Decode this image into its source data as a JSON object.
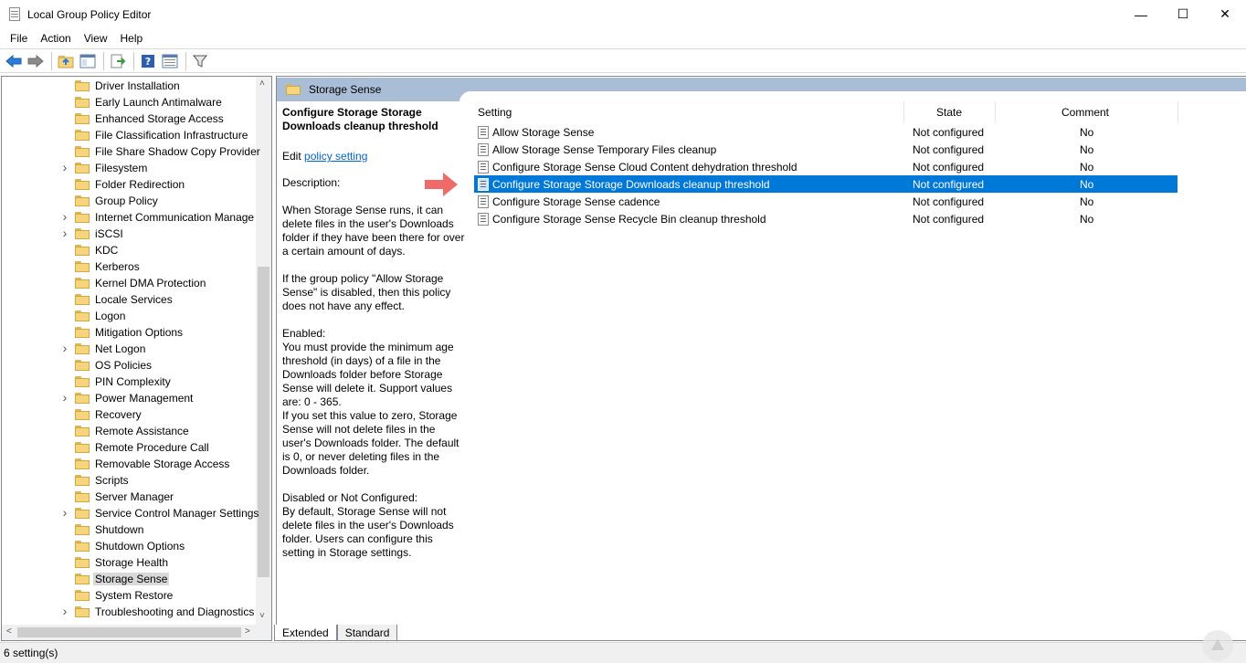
{
  "window": {
    "title": "Local Group Policy Editor"
  },
  "menu": [
    "File",
    "Action",
    "View",
    "Help"
  ],
  "toolbar": {
    "icons": [
      "back-arrow-icon",
      "forward-arrow-icon",
      "up-folder-icon",
      "show-hide-tree-icon",
      "export-list-icon",
      "help-icon",
      "properties-icon",
      "filter-icon"
    ]
  },
  "tree": {
    "items": [
      {
        "label": "Driver Installation",
        "expandable": false
      },
      {
        "label": "Early Launch Antimalware",
        "expandable": false
      },
      {
        "label": "Enhanced Storage Access",
        "expandable": false
      },
      {
        "label": "File Classification Infrastructure",
        "expandable": false
      },
      {
        "label": "File Share Shadow Copy Provider",
        "expandable": false
      },
      {
        "label": "Filesystem",
        "expandable": true
      },
      {
        "label": "Folder Redirection",
        "expandable": false
      },
      {
        "label": "Group Policy",
        "expandable": false
      },
      {
        "label": "Internet Communication Manage",
        "expandable": true
      },
      {
        "label": "iSCSI",
        "expandable": true
      },
      {
        "label": "KDC",
        "expandable": false
      },
      {
        "label": "Kerberos",
        "expandable": false
      },
      {
        "label": "Kernel DMA Protection",
        "expandable": false
      },
      {
        "label": "Locale Services",
        "expandable": false
      },
      {
        "label": "Logon",
        "expandable": false
      },
      {
        "label": "Mitigation Options",
        "expandable": false
      },
      {
        "label": "Net Logon",
        "expandable": true
      },
      {
        "label": "OS Policies",
        "expandable": false
      },
      {
        "label": "PIN Complexity",
        "expandable": false
      },
      {
        "label": "Power Management",
        "expandable": true
      },
      {
        "label": "Recovery",
        "expandable": false
      },
      {
        "label": "Remote Assistance",
        "expandable": false
      },
      {
        "label": "Remote Procedure Call",
        "expandable": false
      },
      {
        "label": "Removable Storage Access",
        "expandable": false
      },
      {
        "label": "Scripts",
        "expandable": false
      },
      {
        "label": "Server Manager",
        "expandable": false
      },
      {
        "label": "Service Control Manager Settings",
        "expandable": true
      },
      {
        "label": "Shutdown",
        "expandable": false
      },
      {
        "label": "Shutdown Options",
        "expandable": false
      },
      {
        "label": "Storage Health",
        "expandable": false
      },
      {
        "label": "Storage Sense",
        "expandable": false,
        "selected": true
      },
      {
        "label": "System Restore",
        "expandable": false
      },
      {
        "label": "Troubleshooting and Diagnostics",
        "expandable": true
      }
    ]
  },
  "panel": {
    "header": "Storage Sense",
    "description": {
      "title": "Configure Storage Storage Downloads cleanup threshold",
      "edit_prefix": "Edit",
      "edit_link": "policy setting",
      "paragraphs": [
        "Description:",
        "When Storage Sense runs, it can delete files in the user's Downloads folder if they have been there for over a certain amount of days.",
        "If the group policy \"Allow Storage Sense\" is disabled, then this policy does not have any effect.",
        "Enabled:\nYou must provide the minimum age threshold (in days) of a file in the Downloads folder before Storage Sense will delete it. Support values are: 0 - 365.\nIf you set this value to zero, Storage Sense will not delete files in the user's Downloads folder. The default is 0, or never deleting files in the Downloads folder.",
        "Disabled or Not Configured:\nBy default, Storage Sense will not delete files in the user's Downloads folder. Users can configure this setting in Storage settings."
      ]
    },
    "columns": [
      "Setting",
      "State",
      "Comment"
    ],
    "rows": [
      {
        "setting": "Allow Storage Sense",
        "state": "Not configured",
        "comment": "No"
      },
      {
        "setting": "Allow Storage Sense Temporary Files cleanup",
        "state": "Not configured",
        "comment": "No"
      },
      {
        "setting": "Configure Storage Sense Cloud Content dehydration threshold",
        "state": "Not configured",
        "comment": "No"
      },
      {
        "setting": "Configure Storage Storage Downloads cleanup threshold",
        "state": "Not configured",
        "comment": "No",
        "selected": true
      },
      {
        "setting": "Configure Storage Sense cadence",
        "state": "Not configured",
        "comment": "No"
      },
      {
        "setting": "Configure Storage Sense Recycle Bin cleanup threshold",
        "state": "Not configured",
        "comment": "No"
      }
    ],
    "tabs": [
      "Extended",
      "Standard"
    ]
  },
  "status": {
    "text": "6 setting(s)"
  },
  "colors": {
    "selection": "#0078d7",
    "header_band": "#a9bdd6",
    "arrow": "#f06a6a",
    "link": "#0066cc"
  }
}
